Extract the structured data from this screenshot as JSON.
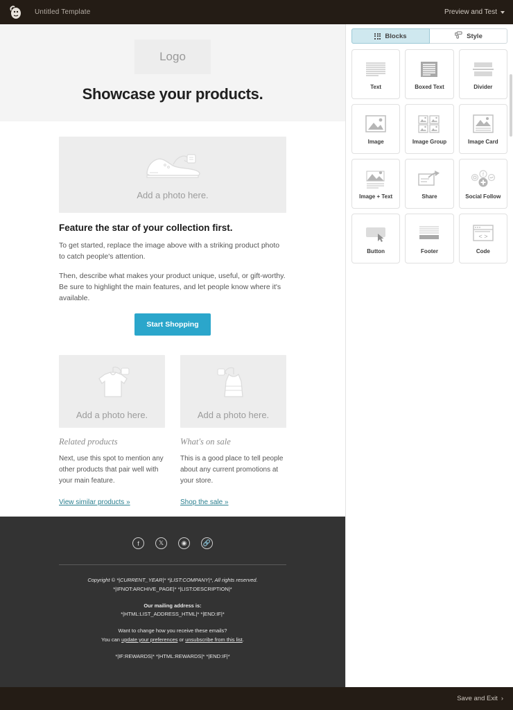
{
  "topbar": {
    "logo_icon": "mailchimp-logo-icon",
    "title": "Untitled Template",
    "preview_label": "Preview and Test"
  },
  "email": {
    "logo_placeholder": "Logo",
    "headline": "Showcase your products.",
    "hero": {
      "placeholder_text": "Add a photo here.",
      "icon": "shoe-illustration-icon"
    },
    "feature": {
      "heading": "Feature the star of your collection first.",
      "paragraph1": "To get started, replace the image above with a striking product photo to catch people's attention.",
      "paragraph2": "Then, describe what makes your product unique, useful, or gift-worthy. Be sure to highlight the main features, and let people know where it's available.",
      "button_label": "Start Shopping"
    },
    "columns": [
      {
        "placeholder_text": "Add a photo here.",
        "icon": "tshirt-illustration-icon",
        "heading": "Related products",
        "paragraph": "Next, use this spot to mention any other products that pair well with your main feature.",
        "link": "View similar products »"
      },
      {
        "placeholder_text": "Add a photo here.",
        "icon": "dress-illustration-icon",
        "heading": "What's on sale",
        "paragraph": "This is a good place to tell people about any current promotions at your store.",
        "link": "Shop the sale »"
      }
    ],
    "footer": {
      "social": [
        {
          "name": "facebook-icon",
          "glyph": "f"
        },
        {
          "name": "x-twitter-icon",
          "glyph": "𝕏"
        },
        {
          "name": "instagram-icon",
          "glyph": "◉"
        },
        {
          "name": "website-link-icon",
          "glyph": "🔗"
        }
      ],
      "copyright": "Copyright © *|CURRENT_YEAR|* *|LIST:COMPANY|*, All rights reserved.",
      "archive": "*|IFNOT:ARCHIVE_PAGE|* *|LIST:DESCRIPTION|*",
      "address_heading": "Our mailing address is:",
      "address_value": "*|HTML:LIST_ADDRESS_HTML|* *|END:IF|*",
      "prefs_question": "Want to change how you receive these emails?",
      "prefs_prefix": "You can ",
      "prefs_link1": "update your preferences",
      "prefs_middle": " or ",
      "prefs_link2": "unsubscribe from this list",
      "prefs_suffix": ".",
      "rewards": "*|IF:REWARDS|* *|HTML:REWARDS|* *|END:IF|*"
    }
  },
  "panel": {
    "tabs": [
      {
        "label": "Blocks",
        "icon": "grid-dots-icon",
        "active": true
      },
      {
        "label": "Style",
        "icon": "paint-roller-icon",
        "active": false
      }
    ],
    "blocks": [
      {
        "label": "Text",
        "icon": "text-lines-icon"
      },
      {
        "label": "Boxed Text",
        "icon": "boxed-text-icon"
      },
      {
        "label": "Divider",
        "icon": "divider-icon"
      },
      {
        "label": "Image",
        "icon": "image-icon"
      },
      {
        "label": "Image Group",
        "icon": "image-group-icon"
      },
      {
        "label": "Image Card",
        "icon": "image-card-icon"
      },
      {
        "label": "Image + Text",
        "icon": "image-text-icon"
      },
      {
        "label": "Share",
        "icon": "share-icon"
      },
      {
        "label": "Social Follow",
        "icon": "social-follow-icon"
      },
      {
        "label": "Button",
        "icon": "button-icon"
      },
      {
        "label": "Footer",
        "icon": "footer-icon"
      },
      {
        "label": "Code",
        "icon": "code-icon"
      }
    ]
  },
  "bottombar": {
    "save_label": "Save and Exit"
  },
  "colors": {
    "app_chrome": "#241c15",
    "accent_button": "#2BA6CB",
    "link_teal": "#2a7f8f",
    "tab_active": "#cfe8ef",
    "email_footer": "#333333"
  }
}
